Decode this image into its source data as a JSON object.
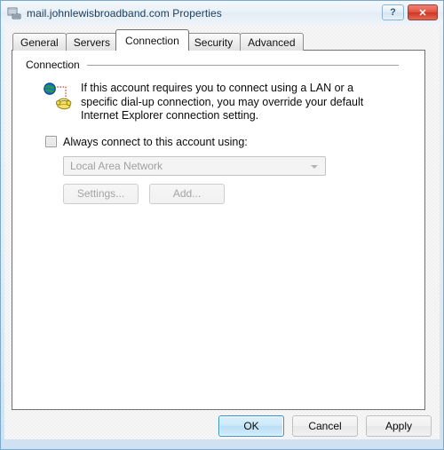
{
  "window": {
    "title": "mail.johnlewisbroadband.com Properties",
    "icon": "mail-account-icon",
    "caption_buttons": [
      {
        "name": "help-button",
        "label": "?"
      },
      {
        "name": "close-button",
        "label": "✕"
      }
    ]
  },
  "tabs": [
    {
      "label": "General",
      "active": false
    },
    {
      "label": "Servers",
      "active": false
    },
    {
      "label": "Connection",
      "active": true
    },
    {
      "label": "Security",
      "active": false
    },
    {
      "label": "Advanced",
      "active": false
    }
  ],
  "group": {
    "title": "Connection",
    "icon": "globe-phone-icon",
    "description": "If this account requires you to connect using a LAN or a specific dial-up connection, you may override your default Internet Explorer connection setting."
  },
  "checkbox": {
    "label": "Always connect to this account using:",
    "checked": false,
    "enabled": true
  },
  "combo": {
    "value": "Local Area Network",
    "enabled": false,
    "arrow_icon": "chevron-down-icon"
  },
  "small_buttons": [
    {
      "name": "settings-button",
      "label": "Settings...",
      "enabled": false
    },
    {
      "name": "add-button",
      "label": "Add...",
      "enabled": false
    }
  ],
  "bottom_buttons": [
    {
      "name": "ok-button",
      "label": "OK",
      "default": true
    },
    {
      "name": "cancel-button",
      "label": "Cancel",
      "default": false
    },
    {
      "name": "apply-button",
      "label": "Apply",
      "default": false
    }
  ],
  "colors": {
    "frame_border": "#7aa9cc",
    "accent_default_button": "#2f93d4",
    "close_button": "#cf3523",
    "disabled_text": "#a4a4a4",
    "dialog_bg": "#f0f0f0",
    "panel_bg": "#ffffff"
  }
}
